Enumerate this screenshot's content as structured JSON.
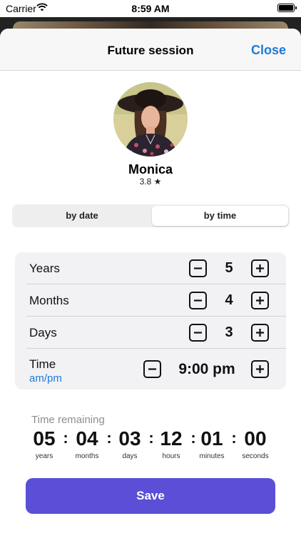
{
  "status_bar": {
    "carrier": "Carrier",
    "time": "8:59 AM"
  },
  "nav": {
    "title": "Future session",
    "close_label": "Close"
  },
  "profile": {
    "name": "Monica",
    "rating": "3.8 ★"
  },
  "segmented": {
    "options": [
      "by date",
      "by time"
    ],
    "selected": "by time"
  },
  "settings": {
    "years": {
      "label": "Years",
      "value": "5"
    },
    "months": {
      "label": "Months",
      "value": "4"
    },
    "days": {
      "label": "Days",
      "value": "3"
    },
    "time": {
      "label": "Time",
      "sublabel": "am/pm",
      "value": "9:00 pm"
    }
  },
  "countdown": {
    "label": "Time remaining",
    "units": [
      {
        "value": "05",
        "unit": "years"
      },
      {
        "value": "04",
        "unit": "months"
      },
      {
        "value": "03",
        "unit": "days"
      },
      {
        "value": "12",
        "unit": "hours"
      },
      {
        "value": "01",
        "unit": "minutes"
      },
      {
        "value": "00",
        "unit": "seconds"
      }
    ]
  },
  "save_label": "Save",
  "colors": {
    "accent": "#5a4fd6",
    "link": "#1d7ad8",
    "card": "#f2f2f5"
  }
}
